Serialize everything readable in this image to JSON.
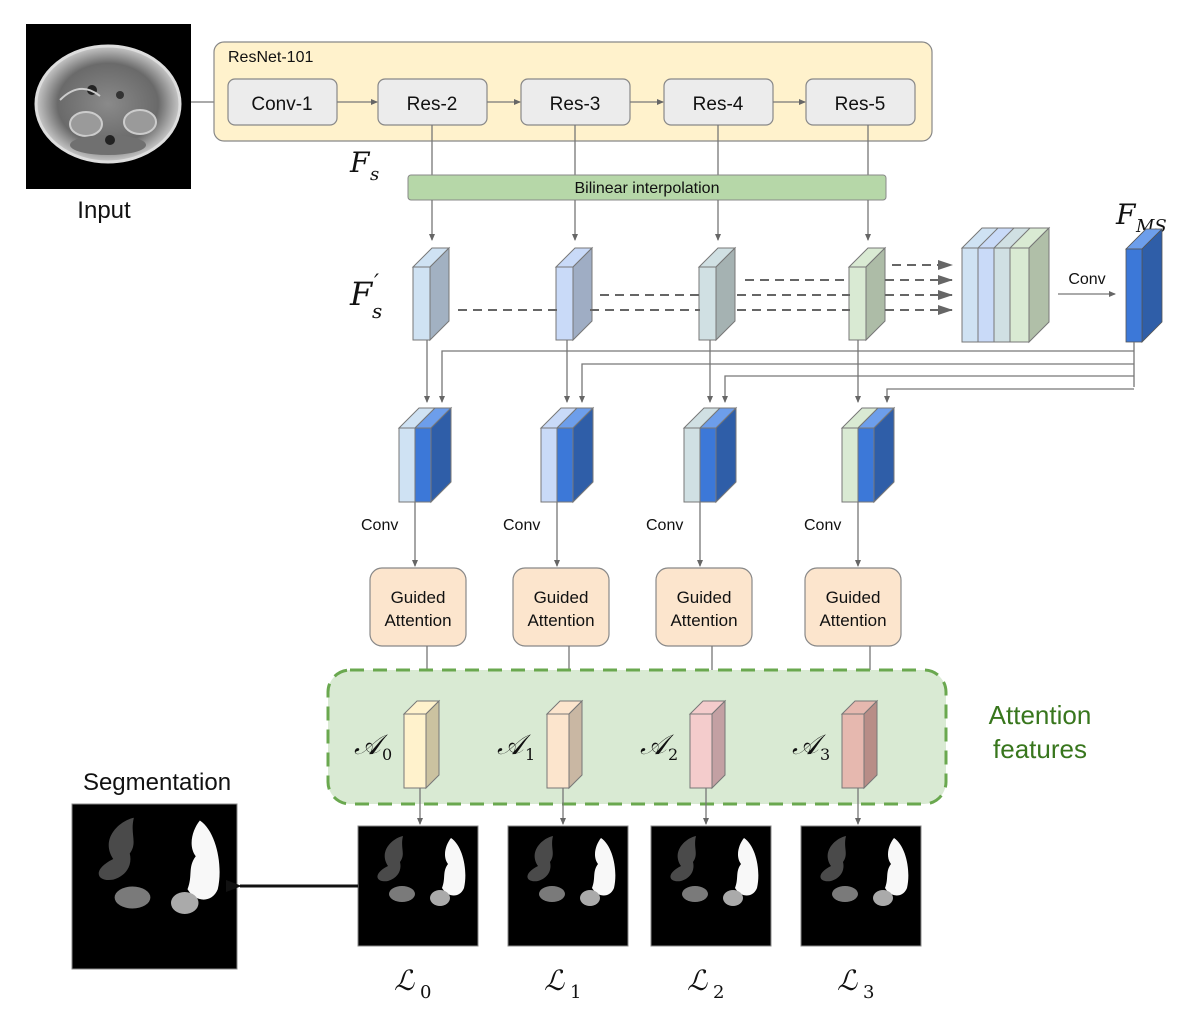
{
  "input": {
    "label": "Input"
  },
  "backbone": {
    "title": "ResNet-101",
    "blocks": [
      "Conv-1",
      "Res-2",
      "Res-3",
      "Res-4",
      "Res-5"
    ],
    "fs_symbol": "F",
    "fs_sub": "s"
  },
  "interp": {
    "label": "Bilinear interpolation"
  },
  "fsprime": {
    "symbol": "F",
    "prime": "′",
    "sub": "s"
  },
  "fms": {
    "symbol": "F",
    "sub": "MS",
    "conv_label": "Conv"
  },
  "branches": [
    {
      "conv_label": "Conv",
      "ga_line1": "Guided",
      "ga_line2": "Attention",
      "a_sym": "𝒜",
      "a_sub": "0",
      "l_sym": "ℒ",
      "l_sub": "0"
    },
    {
      "conv_label": "Conv",
      "ga_line1": "Guided",
      "ga_line2": "Attention",
      "a_sym": "𝒜",
      "a_sub": "1",
      "l_sym": "ℒ",
      "l_sub": "1"
    },
    {
      "conv_label": "Conv",
      "ga_line1": "Guided",
      "ga_line2": "Attention",
      "a_sym": "𝒜",
      "a_sub": "2",
      "l_sym": "ℒ",
      "l_sub": "2"
    },
    {
      "conv_label": "Conv",
      "ga_line1": "Guided",
      "ga_line2": "Attention",
      "a_sym": "𝒜",
      "a_sub": "3",
      "l_sym": "ℒ",
      "l_sub": "3"
    }
  ],
  "attention_group": {
    "line1": "Attention",
    "line2": "features"
  },
  "output": {
    "label": "Segmentation"
  },
  "colors": {
    "backbone_bg": "#fff2cc",
    "block_bg": "#ececec",
    "interp_bg": "#b6d7a8",
    "ga_bg": "#fce5cd",
    "attn_bg": "#d9ead3",
    "attn_border": "#6aa84f",
    "attn_text": "#38761d",
    "fms_front": "#3c78d8",
    "fms_side": "#2f5ea8"
  }
}
